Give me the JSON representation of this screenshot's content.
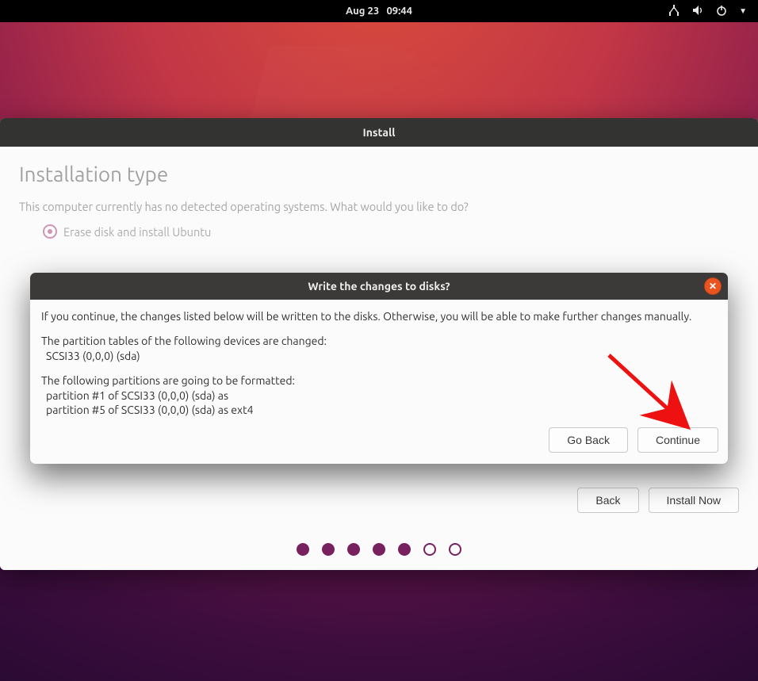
{
  "topbar": {
    "date": "Aug 23",
    "time": "09:44"
  },
  "installer": {
    "window_title": "Install",
    "heading": "Installation type",
    "prompt": "This computer currently has no detected operating systems. What would you like to do?",
    "option_erase": "Erase disk and install Ubuntu",
    "back_label": "Back",
    "install_label": "Install Now"
  },
  "modal": {
    "title": "Write the changes to disks?",
    "line1": "If you continue, the changes listed below will be written to the disks. Otherwise, you will be able to make further changes manually.",
    "line2": "The partition tables of the following devices are changed:",
    "line2_detail": " SCSI33 (0,0,0) (sda)",
    "line3": "The following partitions are going to be formatted:",
    "line3_detail1": " partition #1 of SCSI33 (0,0,0) (sda) as",
    "line3_detail2": " partition #5 of SCSI33 (0,0,0) (sda) as ext4",
    "goback_label": "Go Back",
    "continue_label": "Continue"
  },
  "progress": {
    "total": 7,
    "filled": 5
  }
}
